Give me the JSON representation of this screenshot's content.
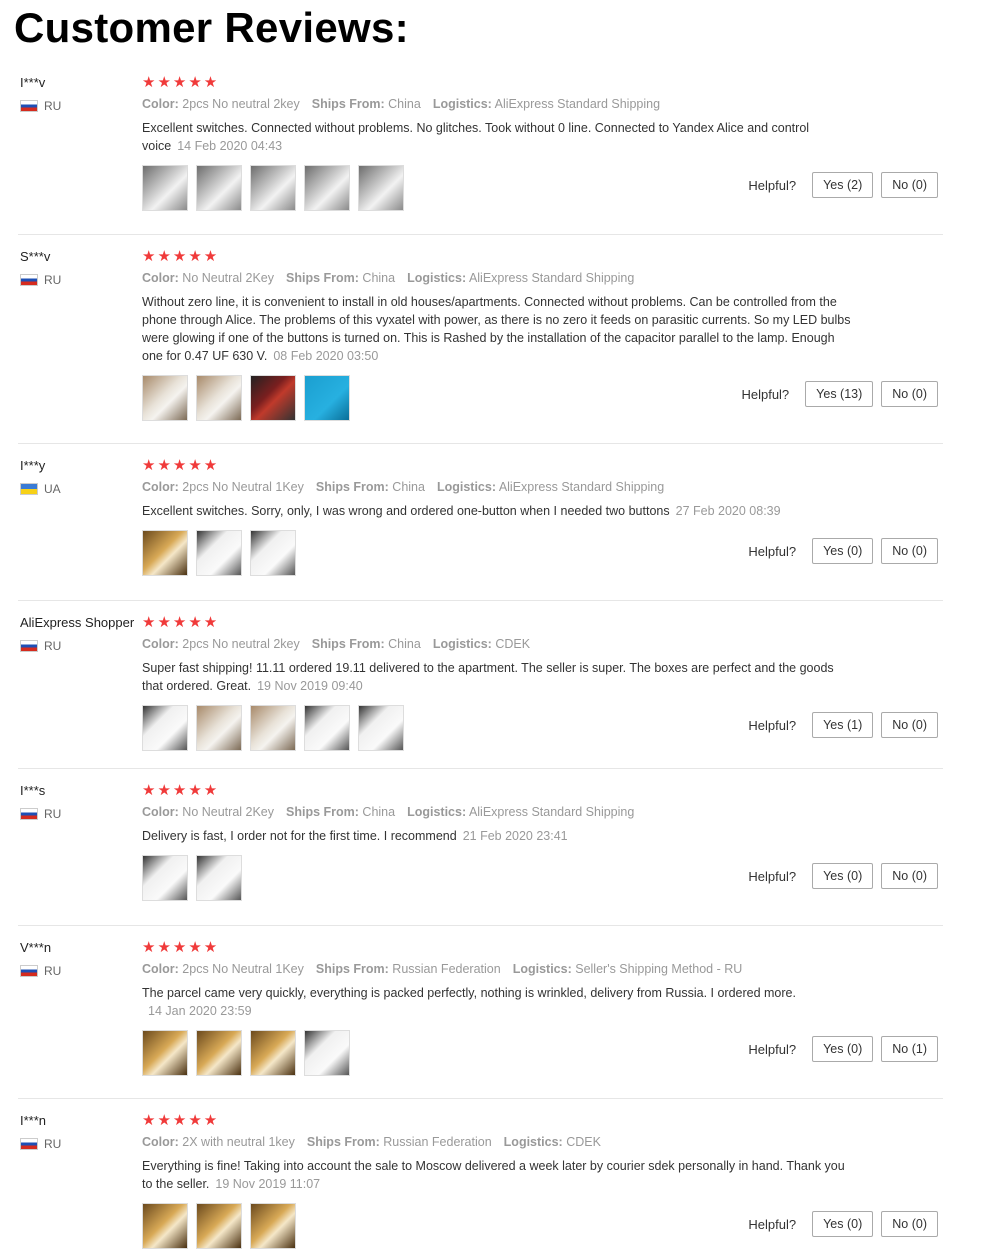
{
  "page_title": "Customer Reviews:",
  "labels": {
    "color": "Color:",
    "ships_from": "Ships From:",
    "logistics": "Logistics:",
    "helpful": "Helpful?"
  },
  "stars_glyph": "★★★★★",
  "reviews": [
    {
      "author": "I***v",
      "country": "RU",
      "color": "2pcs No neutral 2key",
      "ships_from": "China",
      "logistics": "AliExpress Standard Shipping",
      "text": "Excellent switches. Connected without problems. No glitches. Took without 0 line. Connected to Yandex Alice and control voice",
      "date": "14 Feb 2020 04:43",
      "thumb_count": 5,
      "yes": "Yes (2)",
      "no": "No (0)"
    },
    {
      "author": "S***v",
      "country": "RU",
      "color": "No Neutral 2Key",
      "ships_from": "China",
      "logistics": "AliExpress Standard Shipping",
      "text": "Without zero line, it is convenient to install in old houses/apartments. Connected without problems. Can be controlled from the phone through Alice. The problems of this vyxatel with power, as there is no zero it feeds on parasitic currents. So my LED bulbs were glowing if one of the buttons is turned on. This is Rashed by the installation of the capacitor parallel to the lamp. Enough one for 0.47 UF 630 V.",
      "date": "08 Feb 2020 03:50",
      "thumb_count": 4,
      "yes": "Yes (13)",
      "no": "No (0)"
    },
    {
      "author": "I***y",
      "country": "UA",
      "color": "2pcs No Neutral 1Key",
      "ships_from": "China",
      "logistics": "AliExpress Standard Shipping",
      "text": "Excellent switches. Sorry, only, I was wrong and ordered one-button when I needed two buttons",
      "date": "27 Feb 2020 08:39",
      "thumb_count": 3,
      "yes": "Yes (0)",
      "no": "No (0)"
    },
    {
      "author": "AliExpress Shopper",
      "country": "RU",
      "color": "2pcs No neutral 2key",
      "ships_from": "China",
      "logistics": "CDEK",
      "text": "Super fast shipping! 11.11 ordered 19.11 delivered to the apartment. The seller is super. The boxes are perfect and the goods that ordered. Great.",
      "date": "19 Nov 2019 09:40",
      "thumb_count": 5,
      "yes": "Yes (1)",
      "no": "No (0)"
    },
    {
      "author": "I***s",
      "country": "RU",
      "color": "No Neutral 2Key",
      "ships_from": "China",
      "logistics": "AliExpress Standard Shipping",
      "text": "Delivery is fast, I order not for the first time. I recommend",
      "date": "21 Feb 2020 23:41",
      "thumb_count": 2,
      "yes": "Yes (0)",
      "no": "No (0)"
    },
    {
      "author": "V***n",
      "country": "RU",
      "color": "2pcs No Neutral 1Key",
      "ships_from": "Russian Federation",
      "logistics": "Seller's Shipping Method - RU",
      "text": "The parcel came very quickly, everything is packed perfectly, nothing is wrinkled, delivery from Russia. I ordered more.",
      "date": "14 Jan 2020 23:59",
      "thumb_count": 4,
      "yes": "Yes (0)",
      "no": "No (1)"
    },
    {
      "author": "I***n",
      "country": "RU",
      "color": "2X with neutral 1key",
      "ships_from": "Russian Federation",
      "logistics": "CDEK",
      "text": "Everything is fine! Taking into account the sale to Moscow delivered a week later by courier sdek personally in hand. Thank you to the seller.",
      "date": "19 Nov 2019 11:07",
      "thumb_count": 3,
      "yes": "Yes (0)",
      "no": "No (0)"
    }
  ]
}
